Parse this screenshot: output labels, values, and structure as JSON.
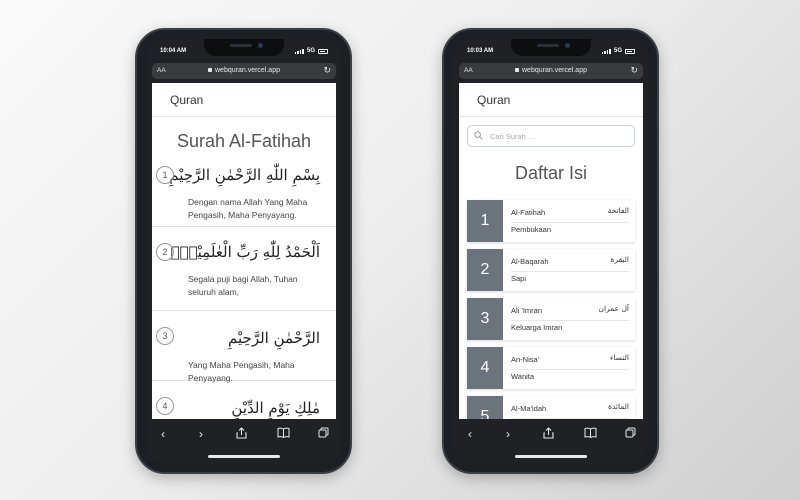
{
  "left_phone": {
    "status": {
      "time": "10:04 AM",
      "network": "5G"
    },
    "browser": {
      "text_size_label": "AA",
      "url": "webquran.vercel.app"
    },
    "navbar": {
      "brand": "Quran"
    },
    "surah_title": "Surah Al-Fatihah",
    "ayat": [
      {
        "number": "1",
        "arabic": "بِسْمِ اللّٰهِ الرَّحْمٰنِ الرَّحِيْمِ",
        "translation": "Dengan nama Allah Yang Maha Pengasih, Maha Penyayang."
      },
      {
        "number": "2",
        "arabic": "اَلْحَمْدُ لِلّٰهِ رَبِّ الْعٰلَمِيْنَۙ",
        "translation": "Segala puji bagi Allah, Tuhan seluruh alam,"
      },
      {
        "number": "3",
        "arabic": "الرَّحْمٰنِ الرَّحِيْمِ",
        "translation": "Yang Maha Pengasih, Maha Penyayang."
      },
      {
        "number": "4",
        "arabic": "مٰلِكِ يَوْمِ الدِّيْنِ",
        "translation": ""
      }
    ]
  },
  "right_phone": {
    "status": {
      "time": "10:03 AM",
      "network": "5G"
    },
    "browser": {
      "text_size_label": "AA",
      "url": "webquran.vercel.app"
    },
    "navbar": {
      "brand": "Quran"
    },
    "search": {
      "placeholder": "Cari Surah ..."
    },
    "page_title": "Daftar Isi",
    "surahs": [
      {
        "number": "1",
        "latin": "Al-Fatihah",
        "arabic": "الفاتحة",
        "meaning": "Pembukaan"
      },
      {
        "number": "2",
        "latin": "Al-Baqarah",
        "arabic": "البقرة",
        "meaning": "Sapi"
      },
      {
        "number": "3",
        "latin": "Ali 'Imran",
        "arabic": "آل عمران",
        "meaning": "Keluarga Imran"
      },
      {
        "number": "4",
        "latin": "An-Nisa'",
        "arabic": "النساء",
        "meaning": "Wanita"
      },
      {
        "number": "5",
        "latin": "Al-Ma'idah",
        "arabic": "المائدة",
        "meaning": ""
      }
    ]
  },
  "toolbar_icons": [
    "back-icon",
    "forward-icon",
    "share-icon",
    "bookmarks-icon",
    "tabs-icon"
  ]
}
